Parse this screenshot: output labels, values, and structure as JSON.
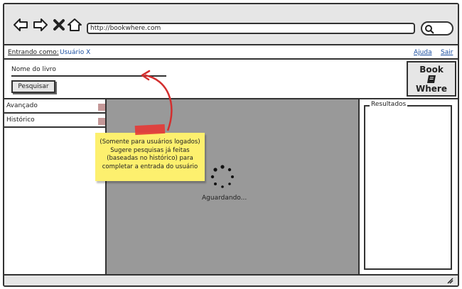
{
  "browser": {
    "url": "http://bookwhere.com"
  },
  "userbar": {
    "logged_in_label": "Entrando como:",
    "user_name": "Usuário X",
    "help_label": "Ajuda",
    "exit_label": "Sair"
  },
  "search": {
    "book_name_label": "Nome do livro",
    "search_button": "Pesquisar"
  },
  "logo": {
    "line1": "Book",
    "line2": "Where"
  },
  "sidebar": {
    "items": [
      {
        "label": "Avançado"
      },
      {
        "label": "Histórico"
      }
    ]
  },
  "main": {
    "waiting_text": "Aguardando..."
  },
  "results": {
    "title": "Resultados"
  },
  "annotation": {
    "note": "(Somente para usuários logados) Sugere pesquisas já feitas (baseadas no histórico) para completar a entrada do usuário"
  },
  "colors": {
    "chrome": "#e6e6e6",
    "link": "#1b4fa0",
    "main_bg": "#999999",
    "sticky": "#fdf06e",
    "arrow": "#d32f2f"
  }
}
